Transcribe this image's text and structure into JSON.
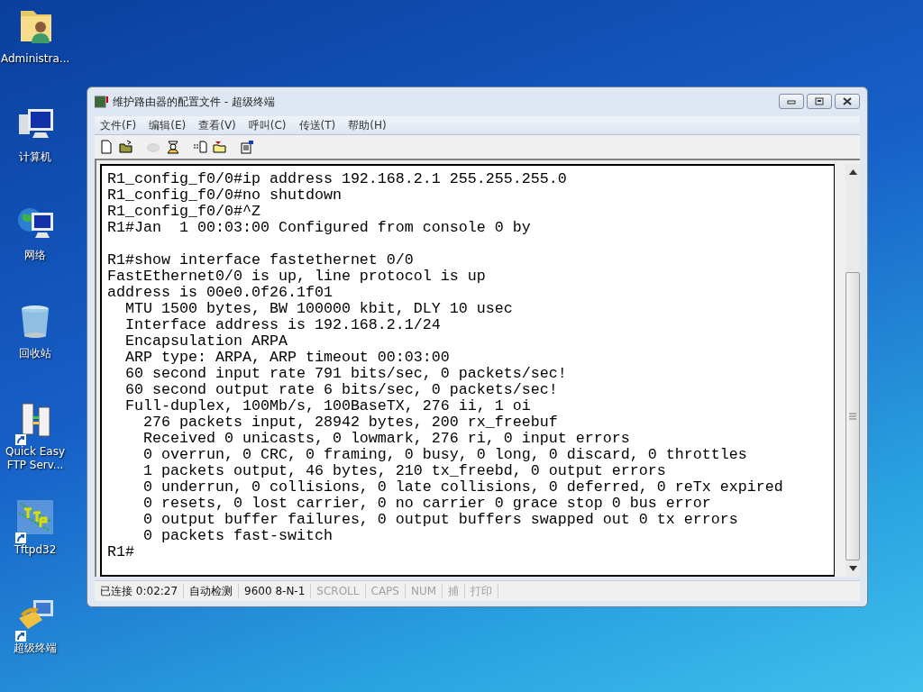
{
  "desktop_icons": [
    {
      "kind": "user-folder",
      "label": "Administra...",
      "shortcut": false
    },
    {
      "kind": "computer",
      "label": "计算机",
      "shortcut": false
    },
    {
      "kind": "network",
      "label": "网络",
      "shortcut": false
    },
    {
      "kind": "recycle-bin",
      "label": "回收站",
      "shortcut": false
    },
    {
      "kind": "ftp-server",
      "label": "Quick Easy FTP Serv...",
      "shortcut": true
    },
    {
      "kind": "tftp",
      "label": "Tftpd32",
      "shortcut": true
    },
    {
      "kind": "phone",
      "label": "超级终端",
      "shortcut": true
    }
  ],
  "window": {
    "title": "维护路由器的配置文件 - 超级终端",
    "menu": [
      "文件(F)",
      "编辑(E)",
      "查看(V)",
      "呼叫(C)",
      "传送(T)",
      "帮助(H)"
    ],
    "toolbar": [
      {
        "kind": "new",
        "disabled": false
      },
      {
        "kind": "open",
        "disabled": false
      },
      {
        "kind": "hangup",
        "disabled": true
      },
      {
        "kind": "dial",
        "disabled": false
      },
      {
        "kind": "send",
        "disabled": false
      },
      {
        "kind": "receive",
        "disabled": false
      },
      {
        "kind": "properties",
        "disabled": false
      }
    ],
    "terminal": [
      [
        "R1_config_f0/0#ip address 192.168.2.1 255.255.255.0",
        "R1_config_f0/0#no shutdown",
        "R1_config_f0/0#^Z",
        "R1#Jan  1 00:03:00 Configured from console 0 by"
      ],
      [
        "R1#show interface fastethernet 0/0",
        "FastEthernet0/0 is up, line protocol is up",
        "address is 00e0.0f26.1f01",
        "  MTU 1500 bytes, BW 100000 kbit, DLY 10 usec",
        "  Interface address is 192.168.2.1/24",
        "  Encapsulation ARPA",
        "  ARP type: ARPA, ARP timeout 00:03:00",
        "  60 second input rate 791 bits/sec, 0 packets/sec!",
        "  60 second output rate 6 bits/sec, 0 packets/sec!",
        "  Full-duplex, 100Mb/s, 100BaseTX, 276 ii, 1 oi",
        "    276 packets input, 28942 bytes, 200 rx_freebuf",
        "    Received 0 unicasts, 0 lowmark, 276 ri, 0 input errors",
        "    0 overrun, 0 CRC, 0 framing, 0 busy, 0 long, 0 discard, 0 throttles",
        "    1 packets output, 46 bytes, 210 tx_freebd, 0 output errors",
        "    0 underrun, 0 collisions, 0 late collisions, 0 deferred, 0 reTx expired",
        "    0 resets, 0 lost carrier, 0 no carrier 0 grace stop 0 bus error",
        "    0 output buffer failures, 0 output buffers swapped out 0 tx errors",
        "    0 packets fast-switch",
        "R1#"
      ]
    ],
    "status_bar": [
      {
        "text": "已连接 0:02:27",
        "on": true
      },
      {
        "text": "自动检测",
        "on": true
      },
      {
        "text": "9600 8-N-1",
        "on": true
      },
      {
        "text": "SCROLL",
        "on": false
      },
      {
        "text": "CAPS",
        "on": false
      },
      {
        "text": "NUM",
        "on": false
      },
      {
        "text": "捕",
        "on": false
      },
      {
        "text": "打印",
        "on": false
      }
    ]
  }
}
